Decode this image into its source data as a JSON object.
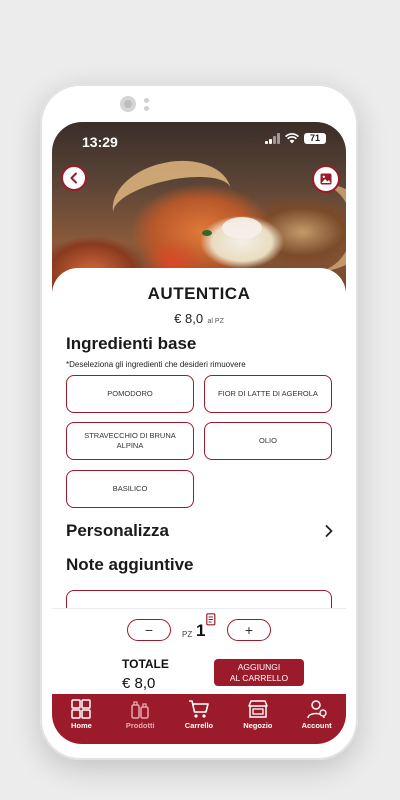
{
  "status_bar": {
    "time": "13:29",
    "battery": "71"
  },
  "product": {
    "name": "AUTENTICA",
    "price": "€ 8,0",
    "price_unit": "al PZ"
  },
  "ingredients_section": {
    "title": "Ingredienti base",
    "hint": "*Deseleziona gli ingredienti che desideri rimuovere",
    "items": [
      {
        "label": "POMODORO"
      },
      {
        "label": "FIOR DI LATTE DI AGEROLA"
      },
      {
        "label": "STRAVECCHIO DI BRUNA ALPINA"
      },
      {
        "label": "OLIO"
      },
      {
        "label": "BASILICO"
      }
    ]
  },
  "customize": {
    "label": "Personalizza"
  },
  "notes": {
    "title": "Note aggiuntive",
    "value": ""
  },
  "quantity": {
    "minus": "−",
    "plus": "+",
    "unit": "PZ",
    "value": "1"
  },
  "total": {
    "label": "TOTALE",
    "value": "€ 8,0"
  },
  "add_to_cart": {
    "line1": "AGGIUNGI",
    "line2": "AL CARRELLO"
  },
  "nav": {
    "items": [
      {
        "label": "Home",
        "icon": "home-grid-icon",
        "active": false
      },
      {
        "label": "Prodotti",
        "icon": "products-icon",
        "active": true
      },
      {
        "label": "Carrello",
        "icon": "cart-icon",
        "active": false
      },
      {
        "label": "Negozio",
        "icon": "store-icon",
        "active": false
      },
      {
        "label": "Account",
        "icon": "account-icon",
        "active": false
      }
    ]
  },
  "colors": {
    "brand": "#9b1b2a",
    "active_nav": "#e8a8b0"
  }
}
